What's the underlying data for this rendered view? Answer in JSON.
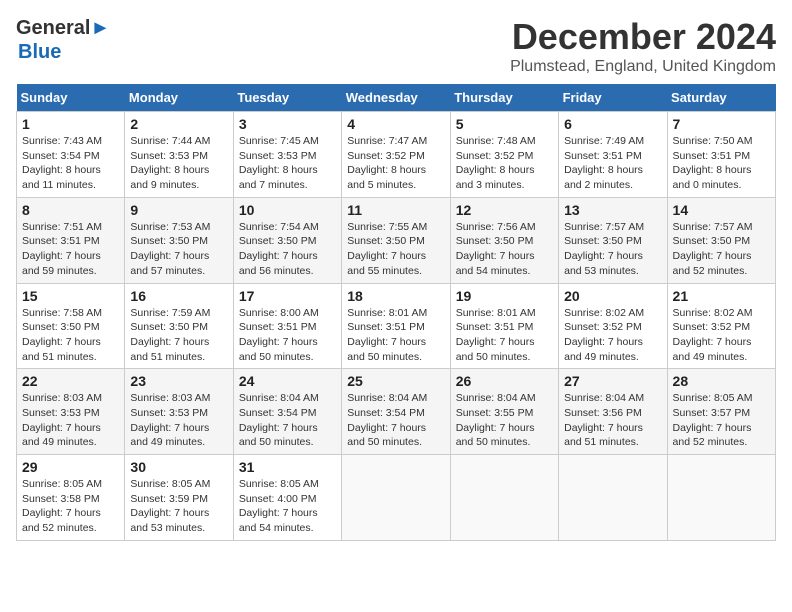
{
  "header": {
    "logo_line1": "General",
    "logo_line2": "Blue",
    "main_title": "December 2024",
    "subtitle": "Plumstead, England, United Kingdom"
  },
  "calendar": {
    "headers": [
      "Sunday",
      "Monday",
      "Tuesday",
      "Wednesday",
      "Thursday",
      "Friday",
      "Saturday"
    ],
    "weeks": [
      [
        {
          "day": "1",
          "detail": "Sunrise: 7:43 AM\nSunset: 3:54 PM\nDaylight: 8 hours\nand 11 minutes."
        },
        {
          "day": "2",
          "detail": "Sunrise: 7:44 AM\nSunset: 3:53 PM\nDaylight: 8 hours\nand 9 minutes."
        },
        {
          "day": "3",
          "detail": "Sunrise: 7:45 AM\nSunset: 3:53 PM\nDaylight: 8 hours\nand 7 minutes."
        },
        {
          "day": "4",
          "detail": "Sunrise: 7:47 AM\nSunset: 3:52 PM\nDaylight: 8 hours\nand 5 minutes."
        },
        {
          "day": "5",
          "detail": "Sunrise: 7:48 AM\nSunset: 3:52 PM\nDaylight: 8 hours\nand 3 minutes."
        },
        {
          "day": "6",
          "detail": "Sunrise: 7:49 AM\nSunset: 3:51 PM\nDaylight: 8 hours\nand 2 minutes."
        },
        {
          "day": "7",
          "detail": "Sunrise: 7:50 AM\nSunset: 3:51 PM\nDaylight: 8 hours\nand 0 minutes."
        }
      ],
      [
        {
          "day": "8",
          "detail": "Sunrise: 7:51 AM\nSunset: 3:51 PM\nDaylight: 7 hours\nand 59 minutes."
        },
        {
          "day": "9",
          "detail": "Sunrise: 7:53 AM\nSunset: 3:50 PM\nDaylight: 7 hours\nand 57 minutes."
        },
        {
          "day": "10",
          "detail": "Sunrise: 7:54 AM\nSunset: 3:50 PM\nDaylight: 7 hours\nand 56 minutes."
        },
        {
          "day": "11",
          "detail": "Sunrise: 7:55 AM\nSunset: 3:50 PM\nDaylight: 7 hours\nand 55 minutes."
        },
        {
          "day": "12",
          "detail": "Sunrise: 7:56 AM\nSunset: 3:50 PM\nDaylight: 7 hours\nand 54 minutes."
        },
        {
          "day": "13",
          "detail": "Sunrise: 7:57 AM\nSunset: 3:50 PM\nDaylight: 7 hours\nand 53 minutes."
        },
        {
          "day": "14",
          "detail": "Sunrise: 7:57 AM\nSunset: 3:50 PM\nDaylight: 7 hours\nand 52 minutes."
        }
      ],
      [
        {
          "day": "15",
          "detail": "Sunrise: 7:58 AM\nSunset: 3:50 PM\nDaylight: 7 hours\nand 51 minutes."
        },
        {
          "day": "16",
          "detail": "Sunrise: 7:59 AM\nSunset: 3:50 PM\nDaylight: 7 hours\nand 51 minutes."
        },
        {
          "day": "17",
          "detail": "Sunrise: 8:00 AM\nSunset: 3:51 PM\nDaylight: 7 hours\nand 50 minutes."
        },
        {
          "day": "18",
          "detail": "Sunrise: 8:01 AM\nSunset: 3:51 PM\nDaylight: 7 hours\nand 50 minutes."
        },
        {
          "day": "19",
          "detail": "Sunrise: 8:01 AM\nSunset: 3:51 PM\nDaylight: 7 hours\nand 50 minutes."
        },
        {
          "day": "20",
          "detail": "Sunrise: 8:02 AM\nSunset: 3:52 PM\nDaylight: 7 hours\nand 49 minutes."
        },
        {
          "day": "21",
          "detail": "Sunrise: 8:02 AM\nSunset: 3:52 PM\nDaylight: 7 hours\nand 49 minutes."
        }
      ],
      [
        {
          "day": "22",
          "detail": "Sunrise: 8:03 AM\nSunset: 3:53 PM\nDaylight: 7 hours\nand 49 minutes."
        },
        {
          "day": "23",
          "detail": "Sunrise: 8:03 AM\nSunset: 3:53 PM\nDaylight: 7 hours\nand 49 minutes."
        },
        {
          "day": "24",
          "detail": "Sunrise: 8:04 AM\nSunset: 3:54 PM\nDaylight: 7 hours\nand 50 minutes."
        },
        {
          "day": "25",
          "detail": "Sunrise: 8:04 AM\nSunset: 3:54 PM\nDaylight: 7 hours\nand 50 minutes."
        },
        {
          "day": "26",
          "detail": "Sunrise: 8:04 AM\nSunset: 3:55 PM\nDaylight: 7 hours\nand 50 minutes."
        },
        {
          "day": "27",
          "detail": "Sunrise: 8:04 AM\nSunset: 3:56 PM\nDaylight: 7 hours\nand 51 minutes."
        },
        {
          "day": "28",
          "detail": "Sunrise: 8:05 AM\nSunset: 3:57 PM\nDaylight: 7 hours\nand 52 minutes."
        }
      ],
      [
        {
          "day": "29",
          "detail": "Sunrise: 8:05 AM\nSunset: 3:58 PM\nDaylight: 7 hours\nand 52 minutes."
        },
        {
          "day": "30",
          "detail": "Sunrise: 8:05 AM\nSunset: 3:59 PM\nDaylight: 7 hours\nand 53 minutes."
        },
        {
          "day": "31",
          "detail": "Sunrise: 8:05 AM\nSunset: 4:00 PM\nDaylight: 7 hours\nand 54 minutes."
        },
        null,
        null,
        null,
        null
      ]
    ]
  }
}
